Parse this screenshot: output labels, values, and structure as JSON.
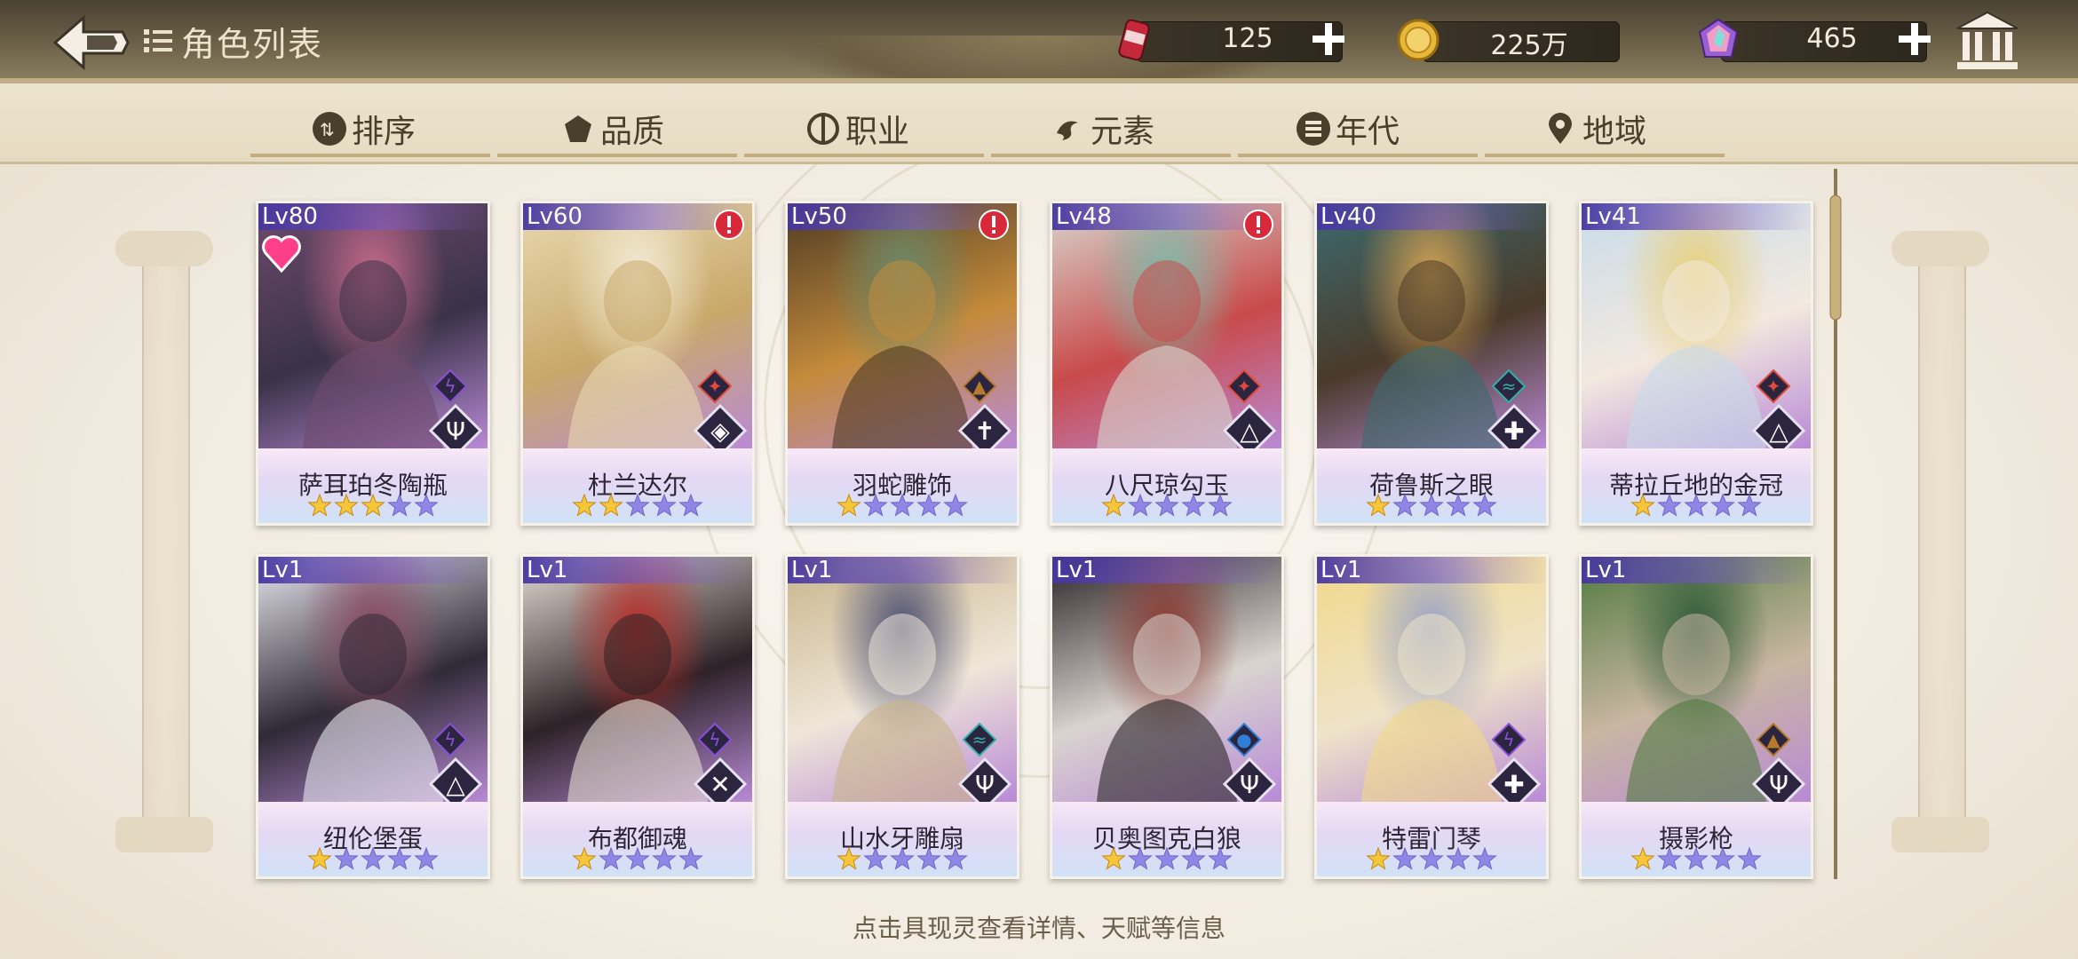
{
  "header": {
    "title": "角色列表",
    "resources": [
      {
        "name": "stamina",
        "value": "125"
      },
      {
        "name": "gold",
        "value": "225万"
      },
      {
        "name": "crystal",
        "value": "465"
      }
    ]
  },
  "tabs": [
    {
      "label": "排序",
      "icon": "sort-icon"
    },
    {
      "label": "品质",
      "icon": "quality-icon"
    },
    {
      "label": "职业",
      "icon": "class-icon"
    },
    {
      "label": "元素",
      "icon": "element-icon"
    },
    {
      "label": "年代",
      "icon": "era-icon"
    },
    {
      "label": "地域",
      "icon": "region-icon"
    }
  ],
  "cards": [
    {
      "level": "Lv80",
      "name": "萨耳珀冬陶瓶",
      "stars": 3,
      "element": "thunder",
      "cls": "trident",
      "alert": false,
      "favorite": true,
      "palette": [
        "#6e4a6c",
        "#c86b8a",
        "#3a3248"
      ]
    },
    {
      "level": "Lv60",
      "name": "杜兰达尔",
      "stars": 2,
      "element": "fire",
      "cls": "shield",
      "alert": true,
      "favorite": false,
      "palette": [
        "#e8d9b0",
        "#f4ecd6",
        "#c9a86a"
      ]
    },
    {
      "level": "Lv50",
      "name": "羽蛇雕饰",
      "stars": 1,
      "element": "earth",
      "cls": "sword",
      "alert": true,
      "favorite": false,
      "palette": [
        "#4e3b24",
        "#6b8a6a",
        "#c48b3b"
      ]
    },
    {
      "level": "Lv48",
      "name": "八尺琼勾玉",
      "stars": 1,
      "element": "fire",
      "cls": "book",
      "alert": true,
      "favorite": false,
      "palette": [
        "#d8d7cf",
        "#7fb8a8",
        "#c94a4a"
      ]
    },
    {
      "level": "Lv40",
      "name": "荷鲁斯之眼",
      "stars": 1,
      "element": "wind",
      "cls": "cross",
      "alert": false,
      "favorite": false,
      "palette": [
        "#3c6a6e",
        "#d2a253",
        "#4a3a2a"
      ]
    },
    {
      "level": "Lv41",
      "name": "蒂拉丘地的金冠",
      "stars": 1,
      "element": "fire",
      "cls": "book",
      "alert": false,
      "favorite": false,
      "palette": [
        "#c8dbea",
        "#e8d07a",
        "#f2e9df"
      ]
    },
    {
      "level": "Lv1",
      "name": "纽伦堡蛋",
      "stars": 1,
      "element": "thunder",
      "cls": "book",
      "alert": false,
      "favorite": false,
      "palette": [
        "#e8e7ef",
        "#8a4a63",
        "#2f2a36"
      ]
    },
    {
      "level": "Lv1",
      "name": "布都御魂",
      "stars": 1,
      "element": "thunder",
      "cls": "swords",
      "alert": false,
      "favorite": false,
      "palette": [
        "#e6ded4",
        "#b8302a",
        "#2c2227"
      ]
    },
    {
      "level": "Lv1",
      "name": "山水牙雕扇",
      "stars": 1,
      "element": "wind",
      "cls": "trident",
      "alert": false,
      "favorite": false,
      "palette": [
        "#c9b48a",
        "#4a4e72",
        "#efe6d8"
      ]
    },
    {
      "level": "Lv1",
      "name": "贝奥图克白狼",
      "stars": 1,
      "element": "water",
      "cls": "trident",
      "alert": false,
      "favorite": false,
      "palette": [
        "#2a2427",
        "#8c3a32",
        "#d9d4cf"
      ]
    },
    {
      "level": "Lv1",
      "name": "特雷门琴",
      "stars": 1,
      "element": "thunder",
      "cls": "cross",
      "alert": false,
      "favorite": false,
      "palette": [
        "#f2d889",
        "#9aa3c4",
        "#efe3c8"
      ]
    },
    {
      "level": "Lv1",
      "name": "摄影枪",
      "stars": 1,
      "element": "earth",
      "cls": "trident",
      "alert": false,
      "favorite": false,
      "palette": [
        "#4f7a3d",
        "#2f5a38",
        "#c9b6a2"
      ]
    }
  ],
  "footer": {
    "hint": "点击具现灵查看详情、天赋等信息"
  }
}
